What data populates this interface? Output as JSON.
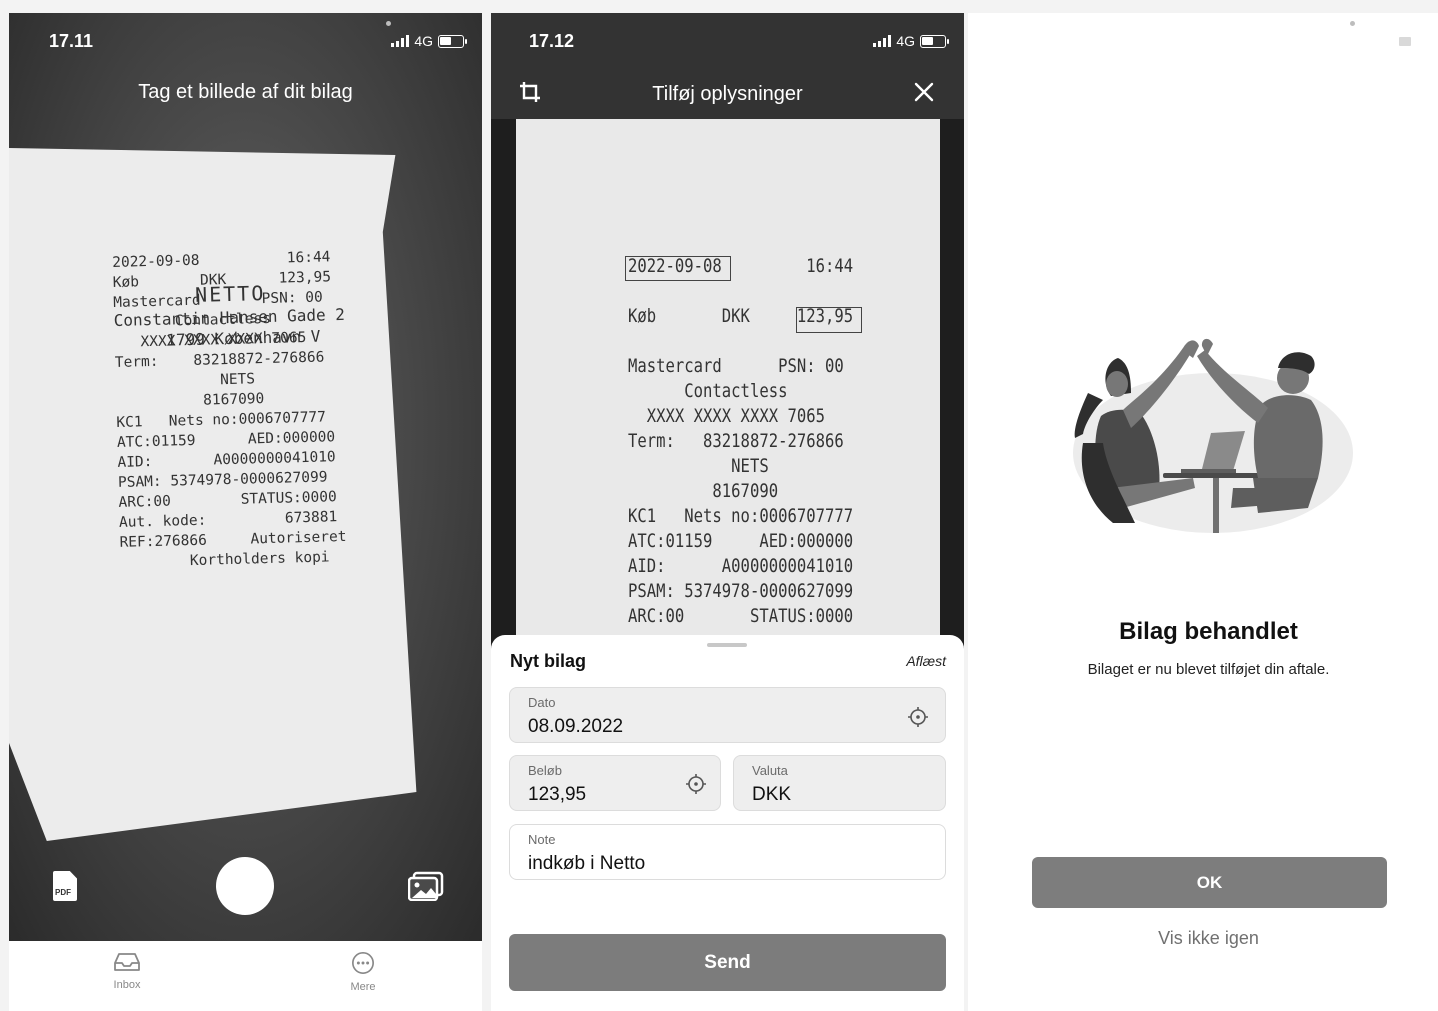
{
  "screen1": {
    "status": {
      "time": "17.11",
      "network": "4G"
    },
    "title": "Tag et billede af dit bilag",
    "receipt_lines": [
      "2022-09-08          16:44",
      "Køb       DKK      123,95",
      "Mastercard       PSN: 00",
      "       Contactless",
      "   XXXX XXXX XXXX 7065",
      "Term:    83218872-276866",
      "            NETS",
      "          8167090",
      "KC1   Nets no:0006707777",
      "ATC:01159      AED:000000",
      "AID:       A0000000041010",
      "PSAM: 5374978-0000627099",
      "ARC:00        STATUS:0000",
      "Aut. kode:         673881",
      "REF:276866     Autoriseret",
      "        Kortholders kopi"
    ],
    "store_name": "NETTO",
    "store_address_1": "Constantin Hansen Gade 2",
    "store_address_2": "1799 København V",
    "pdf_label": "PDF",
    "tabs": [
      {
        "label": "Inbox",
        "icon": "inbox-icon"
      },
      {
        "label": "Mere",
        "icon": "more-icon"
      }
    ]
  },
  "screen2": {
    "status": {
      "time": "17.12",
      "network": "4G"
    },
    "title": "Tilføj oplysninger",
    "receipt_lines": [
      "2022-09-08         16:44",
      "",
      "Køb       DKK     123,95",
      "",
      "Mastercard      PSN: 00",
      "      Contactless",
      "  XXXX XXXX XXXX 7065",
      "Term:   83218872-276866",
      "           NETS",
      "         8167090",
      "KC1   Nets no:0006707777",
      "ATC:01159     AED:000000",
      "AID:      A0000000041010",
      "PSAM: 5374978-0000627099",
      "ARC:00       STATUS:0000"
    ],
    "sheet": {
      "title": "Nyt bilag",
      "status": "Aflæst",
      "date": {
        "label": "Dato",
        "value": "08.09.2022"
      },
      "amount": {
        "label": "Beløb",
        "value": "123,95"
      },
      "currency": {
        "label": "Valuta",
        "value": "DKK"
      },
      "note": {
        "label": "Note",
        "value": "indkøb i Netto"
      },
      "send_label": "Send"
    }
  },
  "screen3": {
    "title": "Bilag behandlet",
    "subtitle": "Bilaget er nu blevet tilføjet din aftale.",
    "ok_label": "OK",
    "skip_label": "Vis ikke igen"
  }
}
